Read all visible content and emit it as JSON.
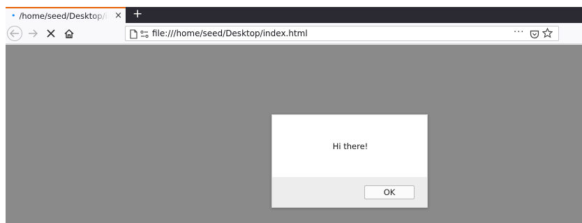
{
  "browser": {
    "tab": {
      "title": "/home/seed/Desktop/index.html",
      "close_label": "×"
    },
    "new_tab_label": "+",
    "url": "file:///home/seed/Desktop/index.html",
    "page_actions_label": "···"
  },
  "dialog": {
    "message": "Hi there!",
    "ok_label": "OK"
  },
  "colors": {
    "tab_accent": "#e66000",
    "tab_dot": "#0a84ff",
    "tabbar_bg": "#2b2a33",
    "content_overlay": "#8a8a8a"
  }
}
